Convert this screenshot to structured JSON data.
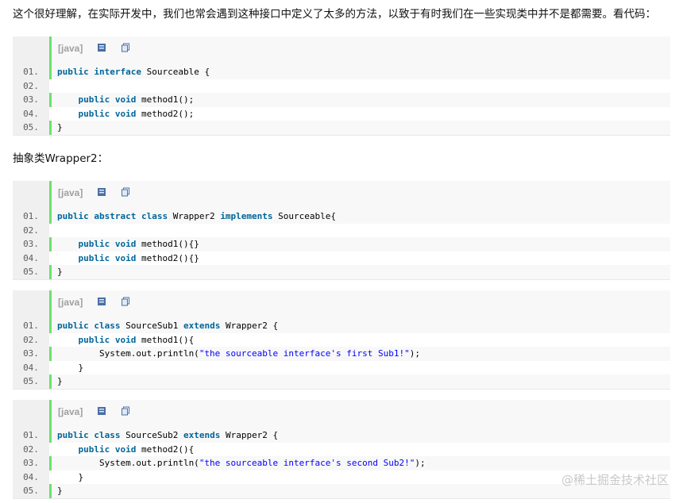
{
  "intro_text": "这个很好理解，在实际开发中，我们也常会遇到这种接口中定义了太多的方法，以致于有时我们在一些实现类中并不是都需要。看代码：",
  "wrapper_text": "抽象类Wrapper2：",
  "toolbar_label": "[java]",
  "watermark": "@稀土掘金技术社区",
  "blocks": [
    {
      "lines": [
        {
          "n": "01.",
          "parts": [
            {
              "t": "public interface",
              "k": 1
            },
            {
              "t": " Sourceable {",
              "k": 0
            }
          ]
        },
        {
          "n": "02.",
          "parts": [
            {
              "t": "",
              "k": 0
            }
          ]
        },
        {
          "n": "03.",
          "parts": [
            {
              "t": "    ",
              "k": 0
            },
            {
              "t": "public void",
              "k": 1
            },
            {
              "t": " method1();",
              "k": 0
            }
          ]
        },
        {
          "n": "04.",
          "parts": [
            {
              "t": "    ",
              "k": 0
            },
            {
              "t": "public void",
              "k": 1
            },
            {
              "t": " method2();",
              "k": 0
            }
          ]
        },
        {
          "n": "05.",
          "parts": [
            {
              "t": "}",
              "k": 0
            }
          ]
        }
      ]
    },
    {
      "lines": [
        {
          "n": "01.",
          "parts": [
            {
              "t": "public abstract class",
              "k": 1
            },
            {
              "t": " Wrapper2 ",
              "k": 0
            },
            {
              "t": "implements",
              "k": 1
            },
            {
              "t": " Sourceable{",
              "k": 0
            }
          ]
        },
        {
          "n": "02.",
          "parts": [
            {
              "t": "",
              "k": 0
            }
          ]
        },
        {
          "n": "03.",
          "parts": [
            {
              "t": "    ",
              "k": 0
            },
            {
              "t": "public void",
              "k": 1
            },
            {
              "t": " method1(){}",
              "k": 0
            }
          ]
        },
        {
          "n": "04.",
          "parts": [
            {
              "t": "    ",
              "k": 0
            },
            {
              "t": "public void",
              "k": 1
            },
            {
              "t": " method2(){}",
              "k": 0
            }
          ]
        },
        {
          "n": "05.",
          "parts": [
            {
              "t": "}",
              "k": 0
            }
          ]
        }
      ]
    },
    {
      "lines": [
        {
          "n": "01.",
          "parts": [
            {
              "t": "public class",
              "k": 1
            },
            {
              "t": " SourceSub1 ",
              "k": 0
            },
            {
              "t": "extends",
              "k": 1
            },
            {
              "t": " Wrapper2 {",
              "k": 0
            }
          ]
        },
        {
          "n": "02.",
          "parts": [
            {
              "t": "    ",
              "k": 0
            },
            {
              "t": "public void",
              "k": 1
            },
            {
              "t": " method1(){",
              "k": 0
            }
          ]
        },
        {
          "n": "03.",
          "parts": [
            {
              "t": "        System.out.println(",
              "k": 0
            },
            {
              "t": "\"the sourceable interface's first Sub1!\"",
              "k": 2
            },
            {
              "t": ");",
              "k": 0
            }
          ]
        },
        {
          "n": "04.",
          "parts": [
            {
              "t": "    }",
              "k": 0
            }
          ]
        },
        {
          "n": "05.",
          "parts": [
            {
              "t": "}",
              "k": 0
            }
          ]
        }
      ]
    },
    {
      "lines": [
        {
          "n": "01.",
          "parts": [
            {
              "t": "public class",
              "k": 1
            },
            {
              "t": " SourceSub2 ",
              "k": 0
            },
            {
              "t": "extends",
              "k": 1
            },
            {
              "t": " Wrapper2 {",
              "k": 0
            }
          ]
        },
        {
          "n": "02.",
          "parts": [
            {
              "t": "    ",
              "k": 0
            },
            {
              "t": "public void",
              "k": 1
            },
            {
              "t": " method2(){",
              "k": 0
            }
          ]
        },
        {
          "n": "03.",
          "parts": [
            {
              "t": "        System.out.println(",
              "k": 0
            },
            {
              "t": "\"the sourceable interface's second Sub2!\"",
              "k": 2
            },
            {
              "t": ");",
              "k": 0
            }
          ]
        },
        {
          "n": "04.",
          "parts": [
            {
              "t": "    }",
              "k": 0
            }
          ]
        },
        {
          "n": "05.",
          "parts": [
            {
              "t": "}",
              "k": 0
            }
          ]
        }
      ]
    }
  ]
}
